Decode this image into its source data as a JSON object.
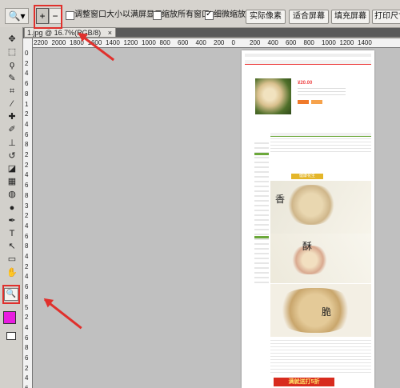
{
  "options_bar": {
    "zoom_in_label": "+",
    "zoom_out_label": "−",
    "resize_windows_label": "调整窗口大小以满屏显示",
    "resize_windows_checked": false,
    "zoom_all_label": "缩放所有窗口",
    "zoom_all_checked": false,
    "scrubby_zoom_label": "细微缩放",
    "scrubby_zoom_checked": true,
    "actual_pixels_label": "实际像素",
    "fit_screen_label": "适合屏幕",
    "fill_screen_label": "填充屏幕",
    "print_size_label": "打印尺寸"
  },
  "document_tab": {
    "title": "1.jpg @ 16.7%(RGB/8)",
    "close": "×"
  },
  "ruler": {
    "h_labels": [
      "2200",
      "2000",
      "1800",
      "1600",
      "1400",
      "1200",
      "1000",
      "800",
      "600",
      "400",
      "200",
      "0",
      "200",
      "400",
      "600",
      "800",
      "1000",
      "1200",
      "1400"
    ],
    "v_labels": [
      "0",
      "2",
      "4",
      "6",
      "8",
      "1",
      "2",
      "4",
      "6",
      "8",
      "2",
      "2",
      "4",
      "6",
      "8",
      "3",
      "2",
      "4",
      "6",
      "8",
      "4",
      "2",
      "4",
      "6",
      "8",
      "5",
      "2",
      "4",
      "6",
      "8",
      "6",
      "2",
      "4",
      "6"
    ]
  },
  "tools": [
    {
      "name": "move-tool",
      "glyph": "✥"
    },
    {
      "name": "marquee-tool",
      "glyph": "⬚"
    },
    {
      "name": "lasso-tool",
      "glyph": "ϙ"
    },
    {
      "name": "quick-select-tool",
      "glyph": "✎"
    },
    {
      "name": "crop-tool",
      "glyph": "⌗"
    },
    {
      "name": "eyedropper-tool",
      "glyph": "⁄"
    },
    {
      "name": "healing-brush-tool",
      "glyph": "✚"
    },
    {
      "name": "brush-tool",
      "glyph": "✐"
    },
    {
      "name": "clone-stamp-tool",
      "glyph": "⊥"
    },
    {
      "name": "history-brush-tool",
      "glyph": "↺"
    },
    {
      "name": "eraser-tool",
      "glyph": "◪"
    },
    {
      "name": "gradient-tool",
      "glyph": "▦"
    },
    {
      "name": "blur-tool",
      "glyph": "◍"
    },
    {
      "name": "dodge-tool",
      "glyph": "●"
    },
    {
      "name": "pen-tool",
      "glyph": "✒"
    },
    {
      "name": "type-tool",
      "glyph": "T"
    },
    {
      "name": "path-select-tool",
      "glyph": "↖"
    },
    {
      "name": "shape-tool",
      "glyph": "▭"
    },
    {
      "name": "hand-tool",
      "glyph": "✋"
    },
    {
      "name": "zoom-tool",
      "glyph": "🔍"
    }
  ],
  "colors": {
    "foreground": "#e81ce0",
    "background": "#ffffff",
    "annotation_red": "#e0302c"
  },
  "webpage": {
    "price": "¥20.00",
    "banner_title": "健康花生",
    "word_1": "香",
    "word_2": "酥",
    "word_3": "脆",
    "bottom_banner": "满就送打5折"
  }
}
